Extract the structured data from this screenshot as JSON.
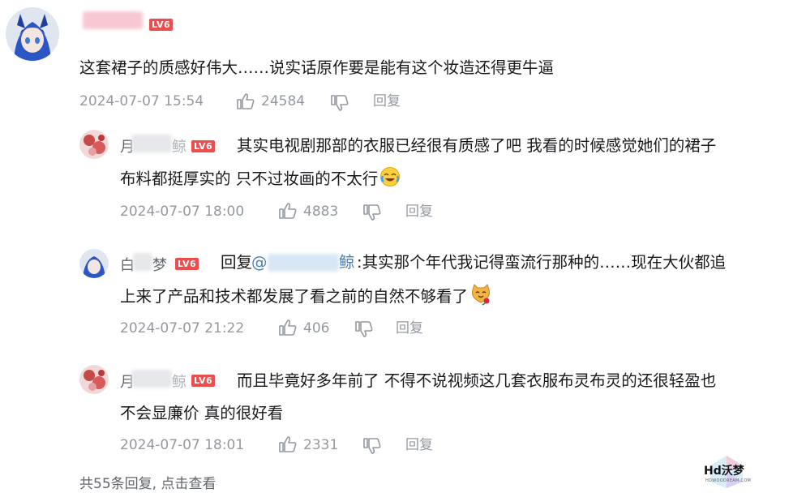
{
  "main_comment": {
    "level": "LV6",
    "text": "这套裙子的质感好伟大……说实话原作要是能有这个妆造还得更牛逼",
    "time": "2024-07-07 15:54",
    "likes": "24584",
    "reply_label": "回复"
  },
  "replies": [
    {
      "name_first": "月",
      "name_last": "鲸",
      "level": "LV6",
      "text_line1": "其实电视剧那部的衣服已经很有质感了吧 我看的时候感觉她们的裙子",
      "text_line2": "布料都挺厚实的 只不过妆画的不太行",
      "time": "2024-07-07 18:00",
      "likes": "4883",
      "reply_label": "回复"
    },
    {
      "name_first": "白",
      "name_last": "梦",
      "level": "LV6",
      "reply_prefix": "回复",
      "mention_at": "@",
      "mention_tail": "鲸",
      "text_line1": ":其实那个年代我记得蛮流行那种的……现在大伙都追",
      "text_line2": "上来了产品和技术都发展了看之前的自然不够看了",
      "time": "2024-07-07 21:22",
      "likes": "406",
      "reply_label": "回复"
    },
    {
      "name_first": "月",
      "name_last": "鲸",
      "level": "LV6",
      "text_line1": "而且毕竟好多年前了 不得不说视频这几套衣服布灵布灵的还很轻盈也",
      "text_line2": "不会显廉价 真的很好看",
      "time": "2024-07-07 18:01",
      "likes": "2331",
      "reply_label": "回复"
    }
  ],
  "footer": {
    "more_replies": "共55条回复, 点击查看"
  },
  "watermark": {
    "text": "Hd沃梦",
    "sub": "HDWOODREAM.COM"
  },
  "colors": {
    "level_badge": "#ee4d4d",
    "meta_gray": "#9499a0",
    "mention_blue": "#4a7fb5"
  },
  "icons": [
    "thumb-up-icon",
    "thumb-down-icon",
    "emoji-laugh-cry",
    "emoji-cat-rose"
  ]
}
